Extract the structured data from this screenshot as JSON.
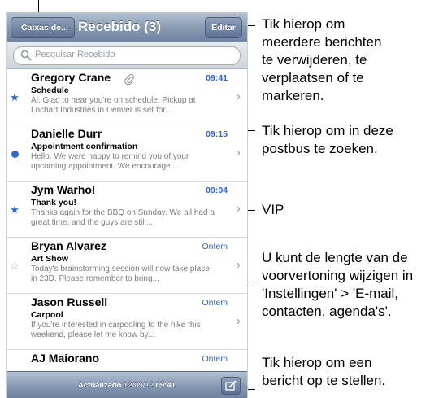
{
  "navbar": {
    "back_label": "Caixas de...",
    "title": "Recebido (3)",
    "edit_label": "Editar"
  },
  "search": {
    "placeholder": "Pesquisar Recebido"
  },
  "messages": [
    {
      "sender": "Gregory Crane",
      "time": "09:41",
      "subject": "Schedule",
      "preview": "Al, Glad to hear you're on schedule. Pickup at Lochart Industries in Denver is set for...",
      "marker": "star",
      "attachment": true
    },
    {
      "sender": "Danielle Durr",
      "time": "09:15",
      "subject": "Appointment confirmation",
      "preview": "Hello. We were happy to remind you of your upcoming appointment. We encourage...",
      "marker": "dot"
    },
    {
      "sender": "Jym Warhol",
      "time": "09:04",
      "subject": "Thank you!",
      "preview": "Thanks again for the BBQ on Sunday. We all had a great time, and the guys are still...",
      "marker": "star"
    },
    {
      "sender": "Bryan Alvarez",
      "time": "Ontem",
      "subject": "Art Show",
      "preview": "Today's brainstorming session will now take place in 23D. Please remember to bring...",
      "marker": "star-outline"
    },
    {
      "sender": "Jason Russell",
      "time": "Ontem",
      "subject": "Carpool",
      "preview": "If you're interested in carpooling to the hike this weekend, please let me know by...",
      "marker": "none"
    },
    {
      "sender": "AJ Maiorano",
      "time": "Ontem"
    }
  ],
  "toolbar": {
    "updated_label": "Actualizado",
    "updated_date": "12/09/12",
    "updated_time": "09:41"
  },
  "callouts": {
    "edit": "Tik hierop om\nmeerdere berichten\nte verwijderen, te\nverplaatsen of te\nmarkeren.",
    "search": "Tik hierop om in deze\npostbus te zoeken.",
    "vip": "VIP",
    "preview": "U kunt de lengte van de\nvoorvertoning wijzigen in\n'Instellingen' > 'E-mail,\ncontacten, agenda's'.",
    "compose": "Tik hierop om een\nbericht op te stellen."
  },
  "colors": {
    "accent": "#2e67d1",
    "navbar": "#7184a1"
  },
  "icons": {
    "search": "search-icon",
    "attachment": "paperclip-icon",
    "chevron": "chevron-right-icon",
    "compose": "compose-icon"
  }
}
